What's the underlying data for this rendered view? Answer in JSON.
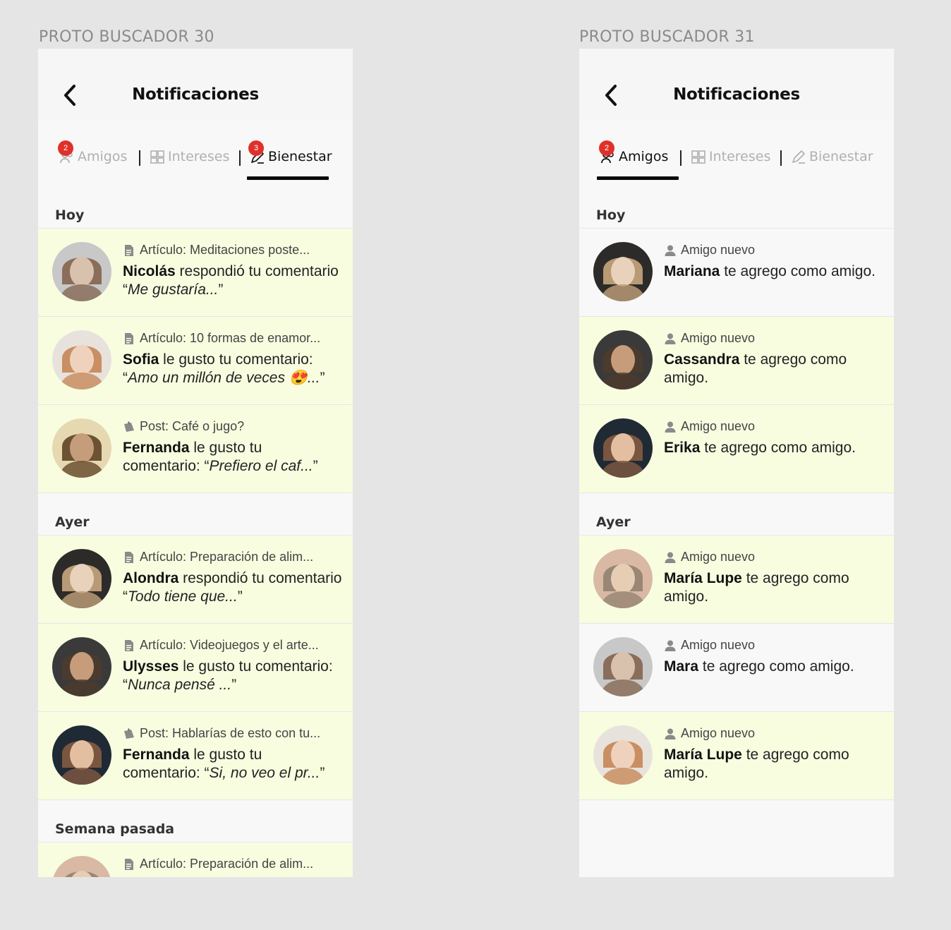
{
  "frames": [
    {
      "label": "PROTO BUSCADOR 30",
      "title": "Notificaciones",
      "tabs": [
        {
          "label": "Amigos",
          "badge": "2",
          "active": false
        },
        {
          "label": "Intereses",
          "badge": "",
          "active": false
        },
        {
          "label": "Bienestar",
          "badge": "3",
          "active": true
        }
      ],
      "sections": [
        {
          "title": "Hoy",
          "items": [
            {
              "meta": "Artículo: Meditaciones poste...",
              "meta_icon": "document-icon",
              "name": "Nicolás",
              "action": " respondió tu comentario “",
              "quote": "Me gustaría...",
              "close": "”",
              "unread": true
            },
            {
              "meta": "Artículo: 10 formas de enamor...",
              "meta_icon": "document-icon",
              "name": "Sofia",
              "action": " le gusto tu comentario: “",
              "quote": "Amo un millón de veces 😍...",
              "close": "”",
              "unread": true
            },
            {
              "meta": "Post: Café o jugo?",
              "meta_icon": "post-icon",
              "name": "Fernanda",
              "action": " le gusto tu comentario: “",
              "quote": "Prefiero el caf...",
              "close": "”",
              "unread": true
            }
          ]
        },
        {
          "title": "Ayer",
          "items": [
            {
              "meta": "Artículo: Preparación de alim...",
              "meta_icon": "document-icon",
              "name": "Alondra",
              "action": " respondió tu comentario “",
              "quote": "Todo tiene que...",
              "close": "”",
              "unread": true
            },
            {
              "meta": "Artículo: Videojuegos y el arte...",
              "meta_icon": "document-icon",
              "name": "Ulysses",
              "action": " le gusto tu comentario: “",
              "quote": "Nunca pensé ...",
              "close": "”",
              "unread": true
            },
            {
              "meta": "Post: Hablarías de esto con tu...",
              "meta_icon": "post-icon",
              "name": "Fernanda",
              "action": " le gusto tu comentario: “",
              "quote": "Si, no veo el pr...",
              "close": "”",
              "unread": true
            }
          ]
        },
        {
          "title": "Semana pasada",
          "items": [
            {
              "meta": "Artículo: Preparación de alim...",
              "meta_icon": "document-icon",
              "name": "",
              "action": "",
              "quote": "",
              "close": "",
              "unread": true
            }
          ]
        }
      ]
    },
    {
      "label": "PROTO BUSCADOR 31",
      "title": "Notificaciones",
      "tabs": [
        {
          "label": "Amigos",
          "badge": "2",
          "active": true
        },
        {
          "label": "Intereses",
          "badge": "",
          "active": false
        },
        {
          "label": "Bienestar",
          "badge": "",
          "active": false
        }
      ],
      "sections": [
        {
          "title": "Hoy",
          "items": [
            {
              "meta": "Amigo nuevo",
              "meta_icon": "person-icon",
              "name": "Mariana",
              "action": " te agrego como amigo.",
              "quote": "",
              "close": "",
              "unread": false
            },
            {
              "meta": "Amigo nuevo",
              "meta_icon": "person-icon",
              "name": "Cassandra",
              "action": " te agrego como amigo.",
              "quote": "",
              "close": "",
              "unread": true
            },
            {
              "meta": "Amigo nuevo",
              "meta_icon": "person-icon",
              "name": "Erika",
              "action": " te agrego como amigo.",
              "quote": "",
              "close": "",
              "unread": true
            }
          ]
        },
        {
          "title": "Ayer",
          "items": [
            {
              "meta": "Amigo nuevo",
              "meta_icon": "person-icon",
              "name": "María Lupe",
              "action": " te agrego como amigo.",
              "quote": "",
              "close": "",
              "unread": true
            },
            {
              "meta": "Amigo nuevo",
              "meta_icon": "person-icon",
              "name": "Mara",
              "action": " te agrego como amigo.",
              "quote": "",
              "close": "",
              "unread": false
            },
            {
              "meta": "Amigo nuevo",
              "meta_icon": "person-icon",
              "name": "María Lupe",
              "action": " te agrego como amigo.",
              "quote": "",
              "close": "",
              "unread": true
            }
          ]
        }
      ]
    }
  ],
  "colors": {
    "unread_bg": "#f8fde0",
    "read_bg": "#f8f8f8",
    "badge": "#e0302a",
    "tab_inactive": "#b0b0b0",
    "page_bg": "#e5e5e5"
  }
}
